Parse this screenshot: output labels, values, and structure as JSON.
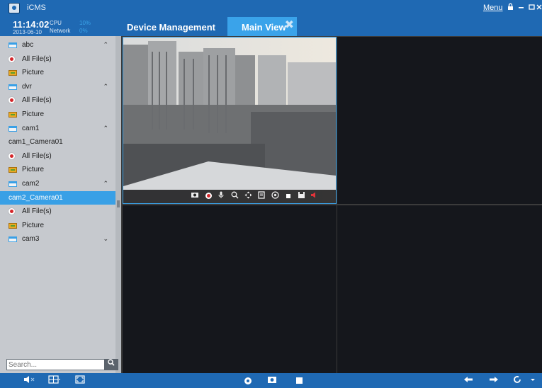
{
  "app": {
    "title": "iCMS",
    "menu_label": "Menu"
  },
  "status": {
    "time": "11:14:02",
    "date": "2013-06-10",
    "cpu_label": "CPU",
    "cpu_value": "10%",
    "network_label": "Network",
    "network_value": "0%"
  },
  "tabs": [
    {
      "label": "Device Management",
      "active": false
    },
    {
      "label": "Main View",
      "active": true,
      "closable": true
    }
  ],
  "tree": [
    {
      "label": "abc",
      "type": "device",
      "expanded": true
    },
    {
      "label": "All File(s)",
      "type": "record"
    },
    {
      "label": "Picture",
      "type": "picture"
    },
    {
      "label": "dvr",
      "type": "device",
      "expanded": true
    },
    {
      "label": "All File(s)",
      "type": "record"
    },
    {
      "label": "Picture",
      "type": "picture"
    },
    {
      "label": "cam1",
      "type": "device",
      "expanded": true
    },
    {
      "label": "cam1_Camera01",
      "type": "channel"
    },
    {
      "label": "All File(s)",
      "type": "record"
    },
    {
      "label": "Picture",
      "type": "picture"
    },
    {
      "label": "cam2",
      "type": "device",
      "expanded": true
    },
    {
      "label": "cam2_Camera01",
      "type": "channel",
      "selected": true
    },
    {
      "label": "All File(s)",
      "type": "record"
    },
    {
      "label": "Picture",
      "type": "picture"
    },
    {
      "label": "cam3",
      "type": "device",
      "expanded": false
    }
  ],
  "search": {
    "placeholder": "Search..."
  },
  "video_toolbar_icons": [
    "snapshot-icon",
    "record-icon",
    "microphone-icon",
    "zoom-icon",
    "ptz-icon",
    "info-icon",
    "fisheye-icon",
    "stop-icon",
    "save-icon",
    "audio-icon"
  ],
  "bottom_toolbar_icons": [
    "volume-icon",
    "layout-icon",
    "fullscreen-icon",
    "record-all-icon",
    "snapshot-all-icon",
    "stop-all-icon",
    "previous-icon",
    "next-icon",
    "refresh-icon",
    "dropdown-icon"
  ],
  "colors": {
    "titlebar": "#1f69b3",
    "accent": "#39a0e6",
    "sidebar": "#c6c9ce",
    "pane_bg": "#15171c"
  }
}
